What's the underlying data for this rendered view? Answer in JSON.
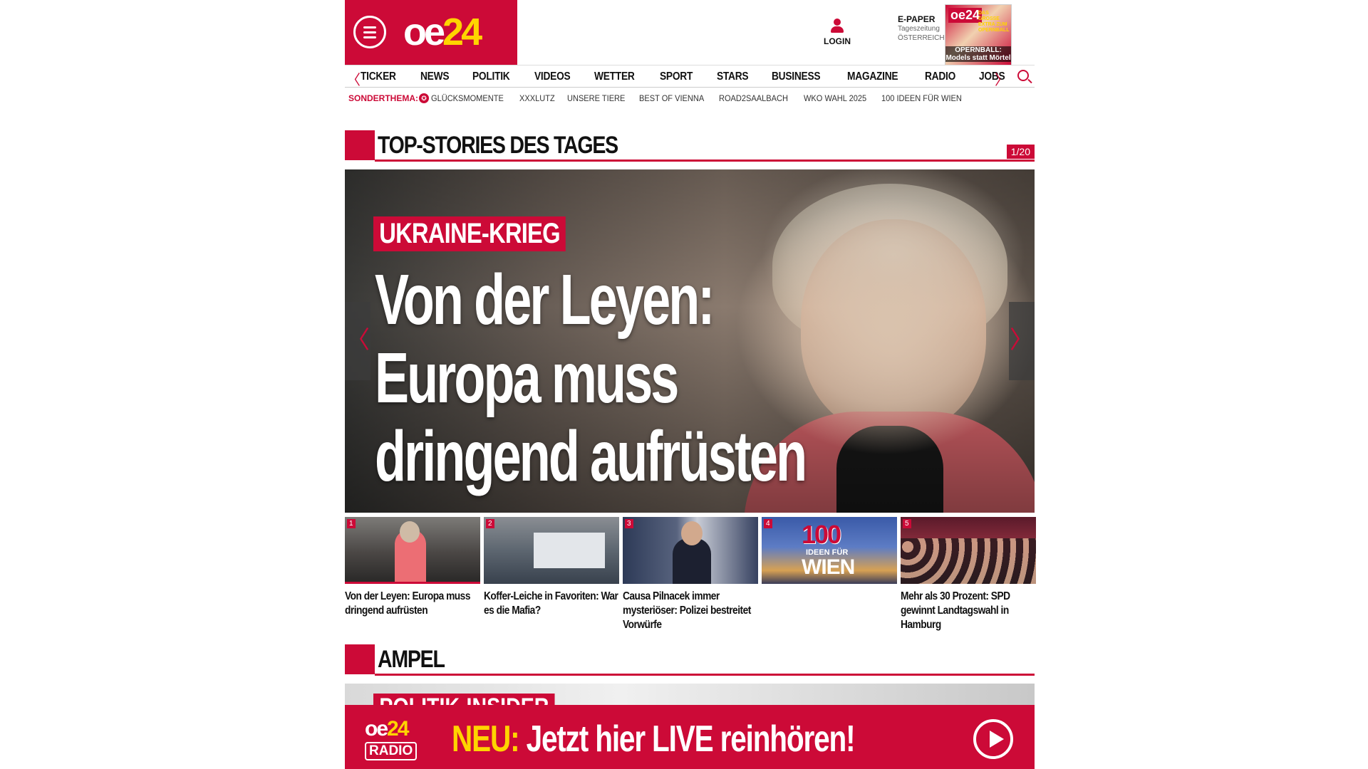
{
  "header": {
    "logo": {
      "part1": "oe",
      "part2": "24"
    },
    "login_label": "LOGIN",
    "epaper": {
      "title": "E-PAPER",
      "line1": "Tageszeitung",
      "line2": "ÖSTERREICH"
    },
    "cover": {
      "brand": "oe24",
      "promo": "DAS GROSSE EXTRA ZUM OPERNBALL",
      "headline": "OPERNBALL: Models statt Mörtel"
    }
  },
  "nav": {
    "items": [
      "TICKER",
      "NEWS",
      "POLITIK",
      "VIDEOS",
      "WETTER",
      "SPORT",
      "STARS",
      "BUSINESS",
      "MAGAZINE",
      "RADIO",
      "JOBS"
    ],
    "prev_glyph": "〈",
    "next_glyph": "〉"
  },
  "subnav": {
    "label": "SONDERTHEMA:",
    "items": [
      "GLÜCKSMOMENTE",
      "XXXLUTZ",
      "UNSERE TIERE",
      "BEST OF VIENNA",
      "ROAD2SAALBACH",
      "WKO WAHL 2025",
      "100 IDEEN FÜR WIEN"
    ]
  },
  "top_stories": {
    "title": "TOP-STORIES DES TAGES",
    "pager": "1/20",
    "hero": {
      "kicker": "UKRAINE-KRIEG",
      "headline_lines": [
        "Von der Leyen:",
        "Europa muss",
        "dringend aufrüsten"
      ]
    },
    "thumbnails": [
      {
        "num": "1",
        "caption": "Von der Leyen: Europa muss dringend aufrüsten"
      },
      {
        "num": "2",
        "caption": "Koffer-Leiche in Favoriten: War es die Mafia?"
      },
      {
        "num": "3",
        "caption": "Causa Pilnacek immer mysteriöser: Polizei bestreitet Vorwürfe"
      },
      {
        "num": "4",
        "caption": "",
        "image_text": {
          "a": "100",
          "b": "IDEEN FÜR",
          "c": "WIEN"
        }
      },
      {
        "num": "5",
        "caption": "Mehr als 30 Prozent: SPD gewinnt Landtagswahl in Hamburg"
      }
    ]
  },
  "ampel": {
    "title": "AMPEL",
    "kicker": "POLITIK-INSIDER"
  },
  "radio_banner": {
    "logo_top": {
      "part1": "oe",
      "part2": "24"
    },
    "logo_bottom": "RADIO",
    "highlight": "NEU:",
    "text": " Jetzt hier LIVE reinhören!"
  },
  "colors": {
    "brand_red": "#cc0a37",
    "brand_yellow": "#ffd400"
  }
}
